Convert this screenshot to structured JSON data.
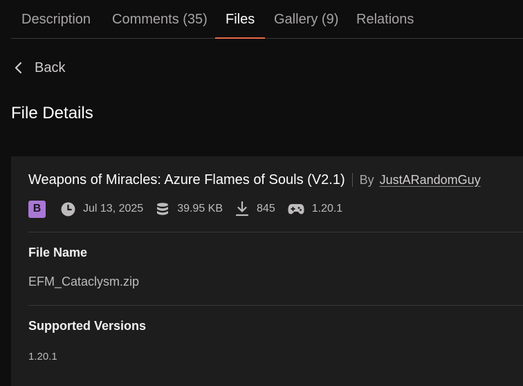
{
  "tabs": [
    {
      "label": "Description"
    },
    {
      "label": "Comments (35)"
    },
    {
      "label": "Files"
    },
    {
      "label": "Gallery (9)"
    },
    {
      "label": "Relations"
    }
  ],
  "active_tab": "Files",
  "back_label": "Back",
  "page_title": "File Details",
  "file": {
    "title": "Weapons of Miracles: Azure Flames of Souls (V2.1)",
    "by_label": "By",
    "author": "JustARandomGuy",
    "badge": "B",
    "badge_color": "#a877d4",
    "date": "Jul 13, 2025",
    "size": "39.95 KB",
    "downloads": "845",
    "game_version": "1.20.1",
    "file_name_label": "File Name",
    "file_name": "EFM_Cataclysm.zip",
    "supported_versions_label": "Supported Versions",
    "supported_versions": "1.20.1"
  },
  "colors": {
    "background": "#0f0e0e",
    "card": "#1e1d1d",
    "accent": "#e8694a"
  },
  "icons": {
    "back": "chevron-left-icon",
    "date": "clock-icon",
    "size": "database-icon",
    "downloads": "download-icon",
    "game_version": "gamepad-icon"
  }
}
